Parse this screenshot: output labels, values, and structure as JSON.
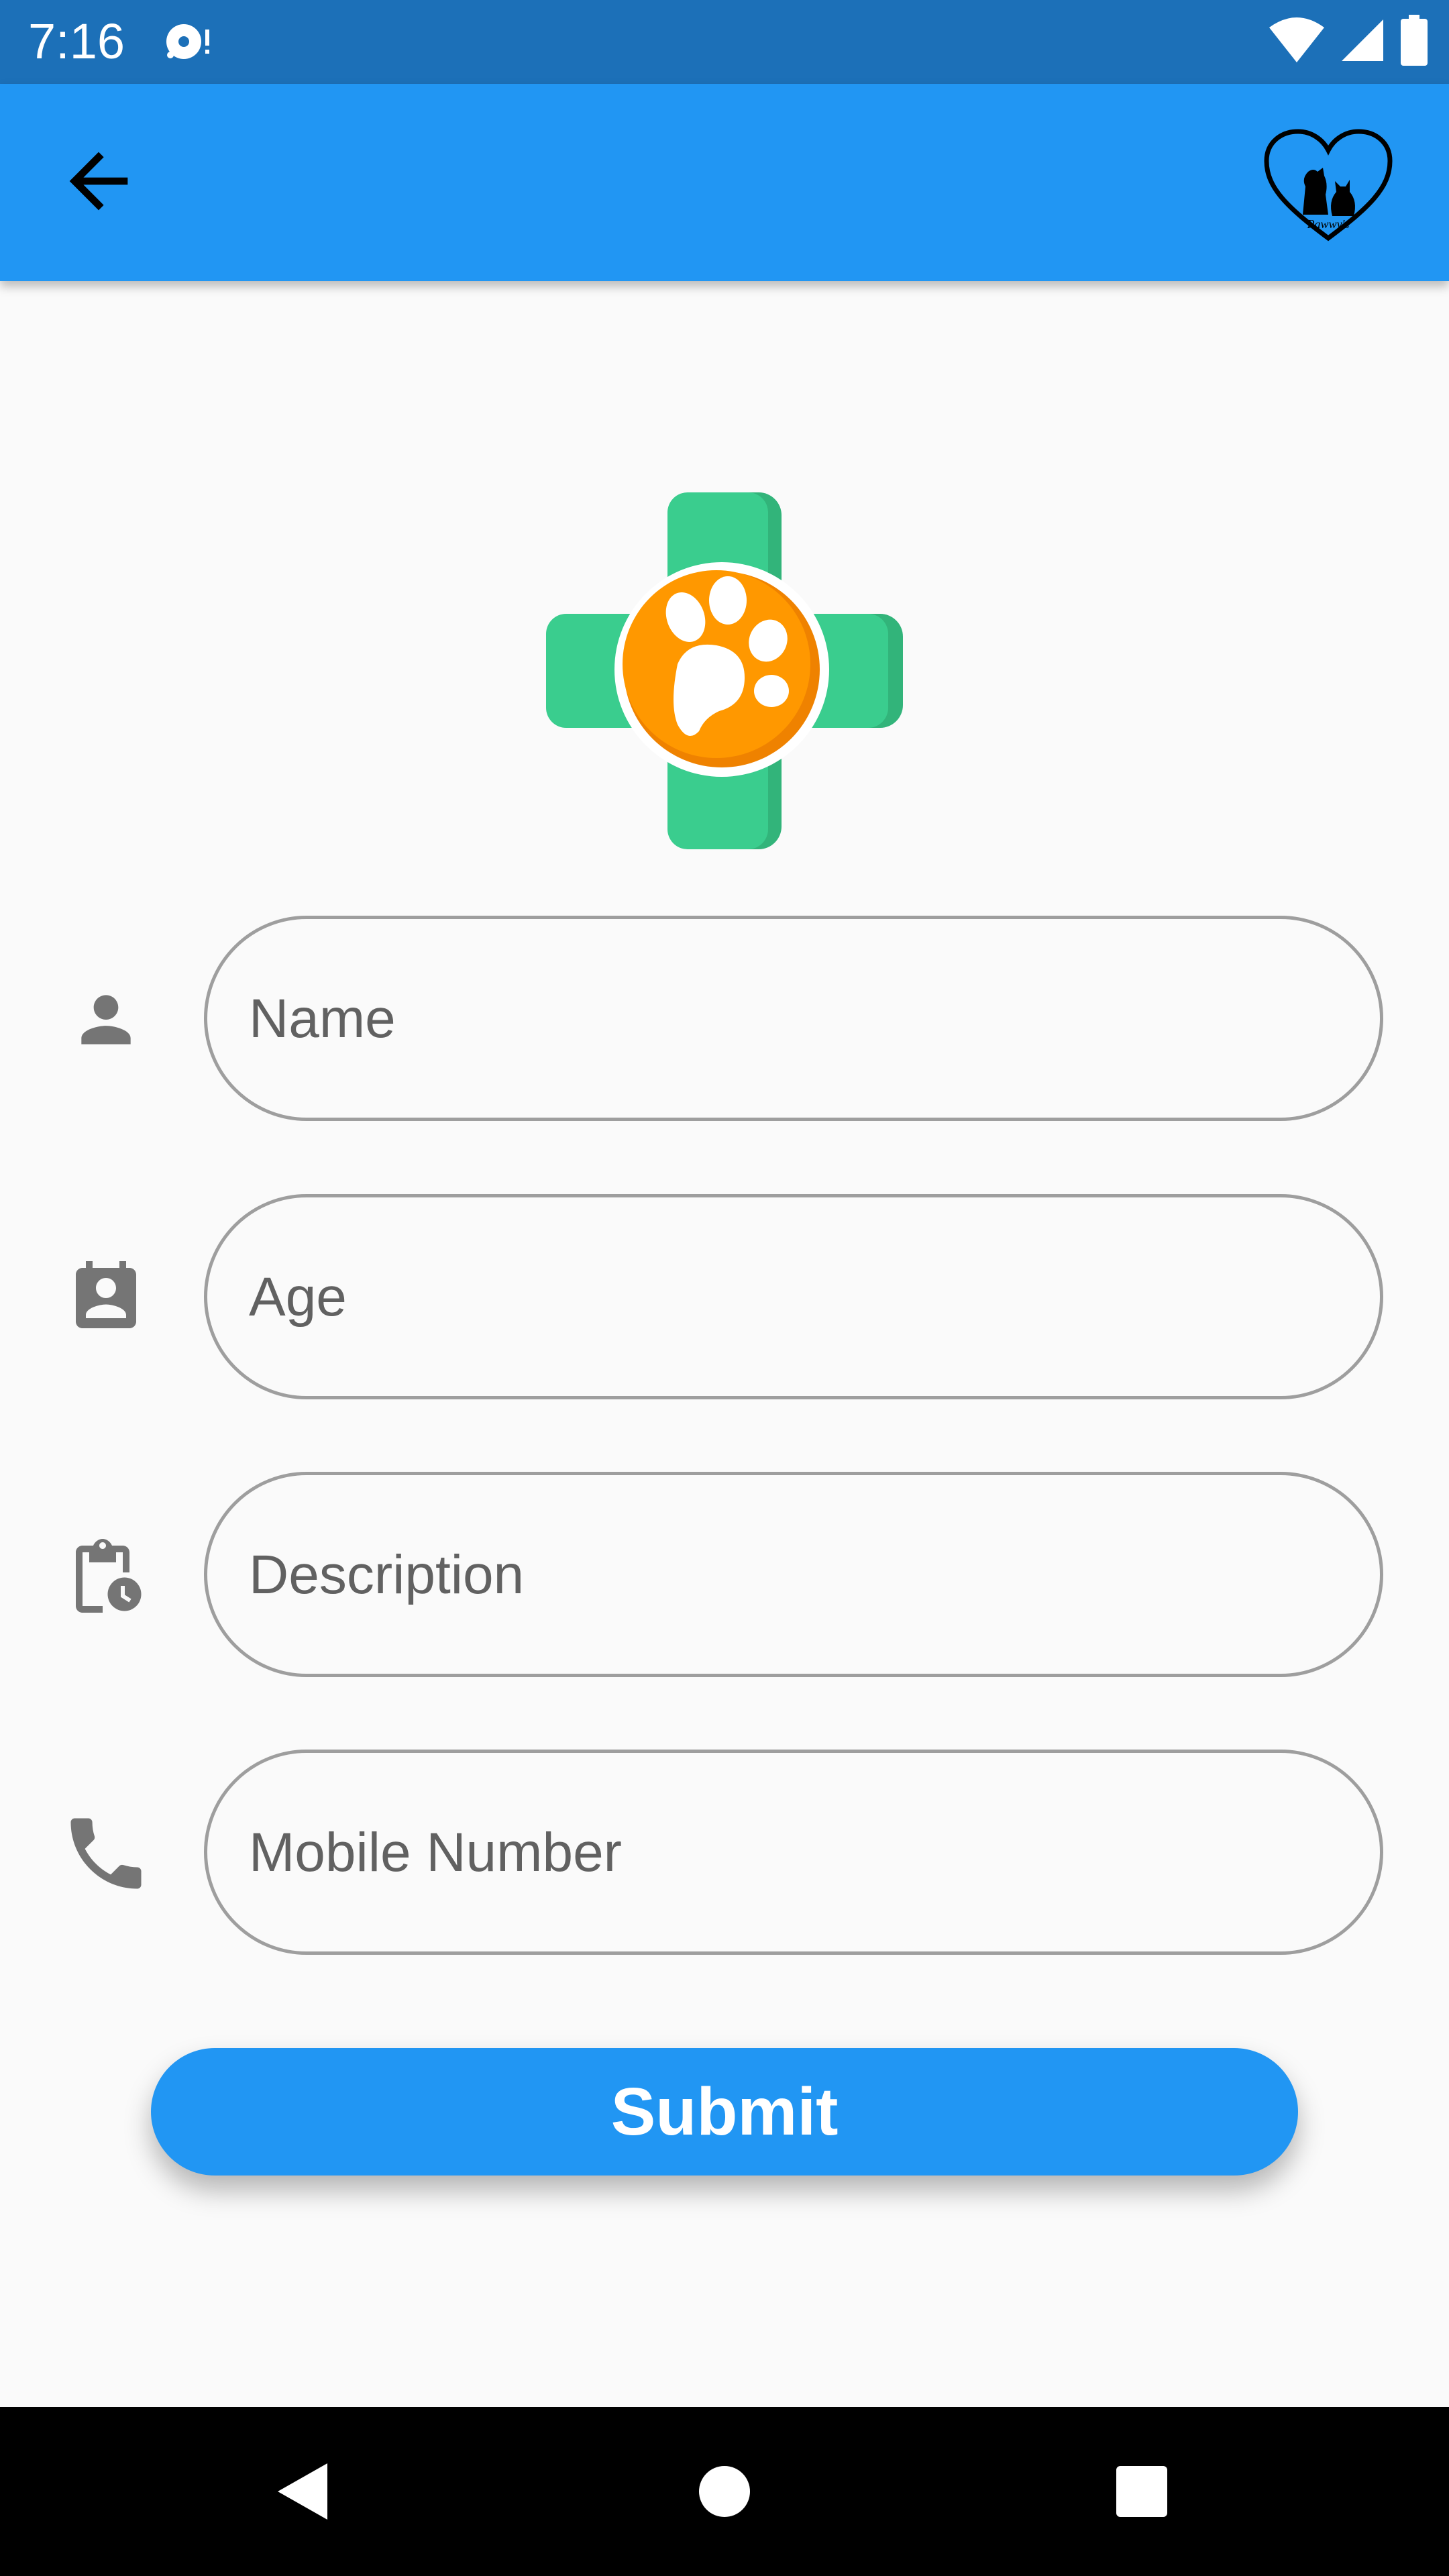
{
  "status_bar": {
    "time": "7:16",
    "icons": [
      "notification-icon",
      "wifi-icon",
      "signal-icon",
      "battery-icon"
    ]
  },
  "app_bar": {
    "background": "#2196f3",
    "back_icon": "arrow-back-icon",
    "logo_icon": "pawwys-heart-logo",
    "logo_text": "Pawwy's"
  },
  "hero": {
    "icon": "vet-cross-paw-logo",
    "cross_color": "#3acd8e",
    "circle_color": "#ff9800"
  },
  "form": {
    "fields": [
      {
        "icon": "person-icon",
        "placeholder": "Name",
        "value": ""
      },
      {
        "icon": "contact-badge-icon",
        "placeholder": "Age",
        "value": ""
      },
      {
        "icon": "clipboard-clock-icon",
        "placeholder": "Description",
        "value": ""
      },
      {
        "icon": "phone-icon",
        "placeholder": "Mobile Number",
        "value": ""
      }
    ],
    "submit_label": "Submit"
  },
  "nav_bar": {
    "icons": [
      "back-triangle-icon",
      "home-circle-icon",
      "recents-square-icon"
    ]
  }
}
